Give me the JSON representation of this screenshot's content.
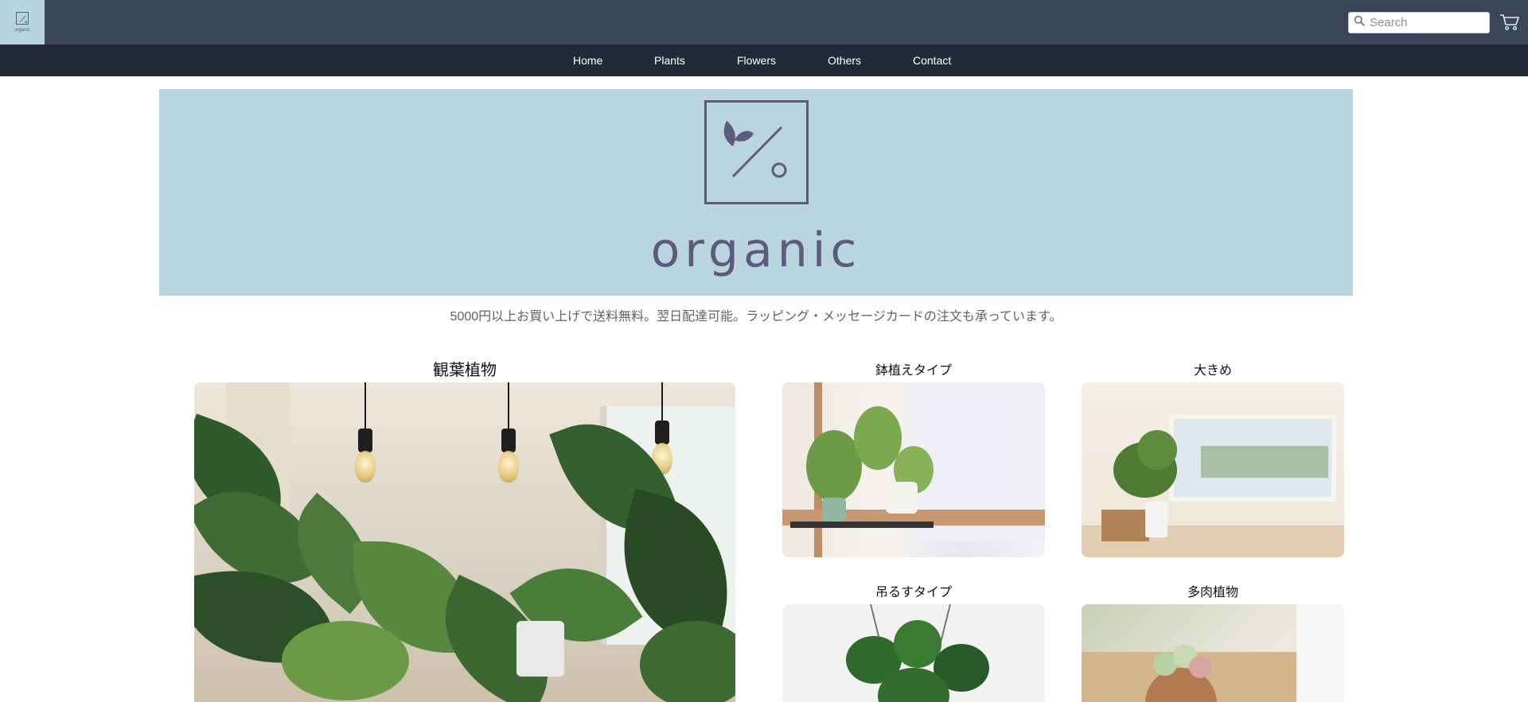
{
  "brand": {
    "name": "organic"
  },
  "search": {
    "placeholder": "Search"
  },
  "nav": {
    "items": [
      {
        "label": "Home"
      },
      {
        "label": "Plants"
      },
      {
        "label": "Flowers"
      },
      {
        "label": "Others"
      },
      {
        "label": "Contact"
      }
    ]
  },
  "banner": {
    "wordmark": "organic"
  },
  "notice": "5000円以上お買い上げで送料無料。翌日配達可能。ラッピング・メッセージカードの注文も承っています。",
  "categories": [
    {
      "title": "観葉植物"
    },
    {
      "title": "鉢植えタイプ"
    },
    {
      "title": "大きめ"
    },
    {
      "title": "吊るすタイプ"
    },
    {
      "title": "多肉植物"
    }
  ],
  "colors": {
    "topbar": "#3a4558",
    "navbar": "#222a37",
    "banner": "#b8d5e0",
    "logo_ink": "#5e5a7b"
  },
  "icons": [
    "search-icon",
    "cart-icon",
    "leaf-icon"
  ]
}
